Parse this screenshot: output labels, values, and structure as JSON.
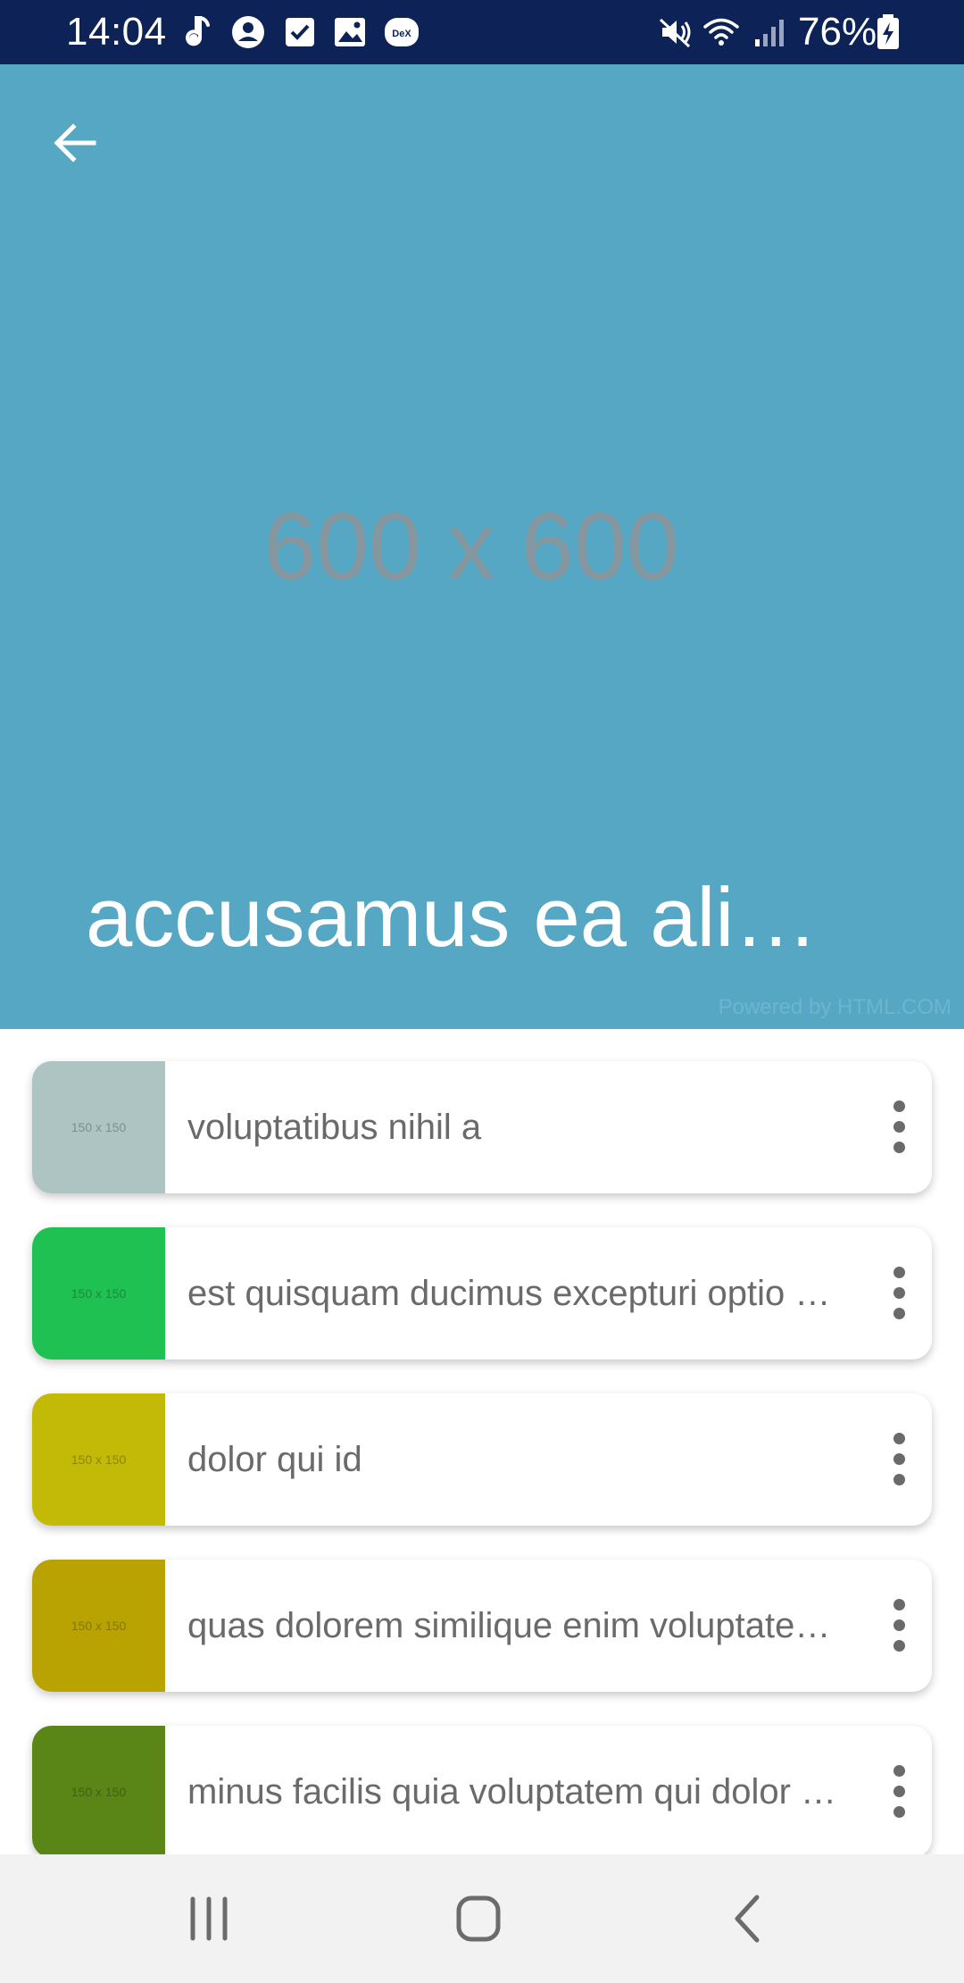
{
  "status_bar": {
    "time": "14:04",
    "battery": "76%",
    "icons": [
      "music-note-icon",
      "account-circle-icon",
      "checkbox-icon",
      "image-icon",
      "dex-icon",
      "mute-icon",
      "wifi-icon",
      "signal-icon",
      "battery-charging-icon"
    ],
    "dex_label": "DeX"
  },
  "hero": {
    "placeholder": "600 x 600",
    "title": "accusamus ea ali…",
    "powered_by": "Powered by HTML.COM",
    "background_color": "#56a7c3"
  },
  "list": {
    "items": [
      {
        "thumb_label": "150 x 150",
        "thumb_color": "#aec4c2",
        "text": "voluptatibus nihil a"
      },
      {
        "thumb_label": "150 x 150",
        "thumb_color": "#1fc153",
        "text": "est quisquam ducimus excepturi optio …"
      },
      {
        "thumb_label": "150 x 150",
        "thumb_color": "#c3b907",
        "text": "dolor qui id"
      },
      {
        "thumb_label": "150 x 150",
        "thumb_color": "#b9a303",
        "text": "quas dolorem similique enim voluptate…"
      },
      {
        "thumb_label": "150 x 150",
        "thumb_color": "#5a8617",
        "text": "minus facilis quia voluptatem qui dolor …"
      }
    ]
  },
  "nav_bar": {
    "icons": [
      "recent-apps-icon",
      "home-icon",
      "back-icon"
    ]
  },
  "colors": {
    "status_bar_bg": "#0d2257",
    "nav_bar_bg": "#f2f2f2",
    "item_text": "#6a6a6a"
  }
}
